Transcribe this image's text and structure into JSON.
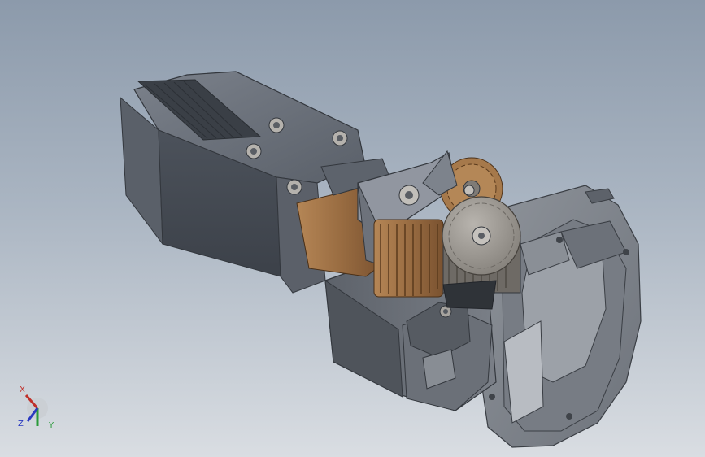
{
  "viewport": {
    "background_top": "#8c9aab",
    "background_bottom": "#d9dde2"
  },
  "model": {
    "parts": [
      "gripper-jaw-upper",
      "gripper-jaw-lower",
      "pivot-link",
      "bronze-gear",
      "spur-gear-upper",
      "spur-gear-main",
      "motor-housing",
      "mounting-flange"
    ],
    "colors": {
      "steel_dark": "#4d535c",
      "steel_mid": "#6a707a",
      "steel_light": "#8a909a",
      "bronze": "#a7784a",
      "bronze_dark": "#7a5230",
      "gear_gray": "#9a9690"
    }
  },
  "triad": {
    "x_label": "X",
    "y_label": "Y",
    "z_label": "Z",
    "x_color": "#c0302a",
    "y_color": "#2a9a3a",
    "z_color": "#2a3ac0"
  }
}
